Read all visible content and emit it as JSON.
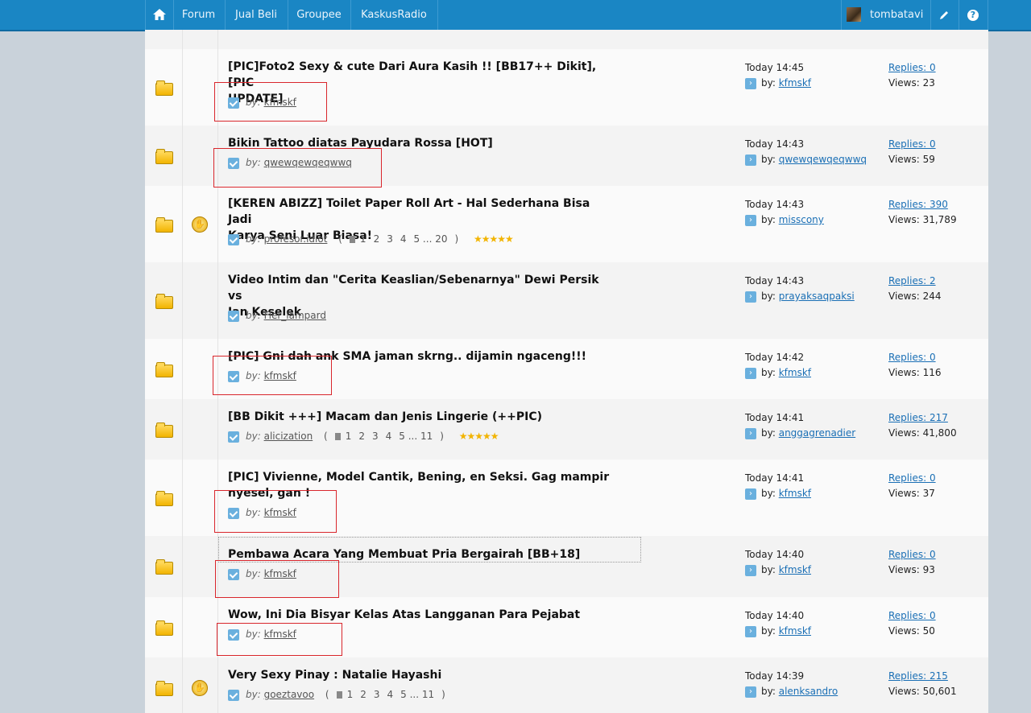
{
  "nav": {
    "forum": "Forum",
    "jual_beli": "Jual Beli",
    "groupee": "Groupee",
    "radio": "KaskusRadio",
    "user": "tombatavi",
    "help_symbol": "?"
  },
  "threads": [
    {
      "title1": "[PIC]Foto2 Sexy & cute Dari Aura Kasih !! [BB17++ Dikit],[PIC",
      "title2": "UPDATE]",
      "by_label": "by:",
      "author": "kfmskf",
      "time": "Today 14:45",
      "last_by_label": "by:",
      "last_user": "kfmskf",
      "replies": "Replies: 0",
      "views": "Views: 23"
    },
    {
      "title1": "Bikin Tattoo diatas Payudara Rossa [HOT]",
      "title2": "",
      "by_label": "by:",
      "author": "qwewqewqeqwwq",
      "time": "Today 14:43",
      "last_by_label": "by:",
      "last_user": "qwewqewqeqwwq",
      "replies": "Replies: 0",
      "views": "Views: 59"
    },
    {
      "title1": "[KEREN ABIZZ] Toilet Paper Roll Art - Hal Sederhana Bisa Jadi",
      "title2": "Karya Seni Luar Biasa!",
      "by_label": "by:",
      "author": "profesor.idiot",
      "pages": [
        "(",
        "1",
        "2",
        "3",
        "4",
        "5 ... 20",
        ")"
      ],
      "stars": "★★★★★",
      "time": "Today 14:43",
      "last_by_label": "by:",
      "last_user": "misscony",
      "replies": "Replies: 390",
      "views": "Views: 31,789"
    },
    {
      "title1": "Video Intim dan \"Cerita Keaslian/Sebenarnya\" Dewi Persik vs",
      "title2": "Ian Keselek",
      "by_label": "by:",
      "author": "Fier_lampard",
      "time": "Today 14:43",
      "last_by_label": "by:",
      "last_user": "prayaksaqpaksi",
      "replies": "Replies: 2",
      "views": "Views: 244"
    },
    {
      "title1": "[PIC] Gni dah ank SMA jaman skrng.. dijamin ngaceng!!!",
      "title2": "",
      "by_label": "by:",
      "author": "kfmskf",
      "time": "Today 14:42",
      "last_by_label": "by:",
      "last_user": "kfmskf",
      "replies": "Replies: 0",
      "views": "Views: 116"
    },
    {
      "title1": "[BB Dikit +++] Macam dan Jenis Lingerie (++PIC)",
      "title2": "",
      "by_label": "by:",
      "author": "alicization",
      "pages": [
        "(",
        "1",
        "2",
        "3",
        "4",
        "5 ... 11",
        ")"
      ],
      "stars": "★★★★★",
      "time": "Today 14:41",
      "last_by_label": "by:",
      "last_user": "anggagrenadier",
      "replies": "Replies: 217",
      "views": "Views: 41,800"
    },
    {
      "title1": "[PIC] Vivienne, Model Cantik, Bening, en Seksi. Gag mampir",
      "title2": "nyesel, gan !",
      "by_label": "by:",
      "author": "kfmskf",
      "time": "Today 14:41",
      "last_by_label": "by:",
      "last_user": "kfmskf",
      "replies": "Replies: 0",
      "views": "Views: 37"
    },
    {
      "title1": "Pembawa Acara Yang Membuat Pria Bergairah [BB+18]",
      "title2": "",
      "by_label": "by:",
      "author": "kfmskf",
      "time": "Today 14:40",
      "last_by_label": "by:",
      "last_user": "kfmskf",
      "replies": "Replies: 0",
      "views": "Views: 93"
    },
    {
      "title1": "Wow, Ini Dia Bisyar Kelas Atas Langganan Para Pejabat",
      "title2": "",
      "by_label": "by:",
      "author": "kfmskf",
      "time": "Today 14:40",
      "last_by_label": "by:",
      "last_user": "kfmskf",
      "replies": "Replies: 0",
      "views": "Views: 50"
    },
    {
      "title1": "Very Sexy Pinay : Natalie Hayashi",
      "title2": "",
      "by_label": "by:",
      "author": "goeztavoo",
      "pages": [
        "(",
        "1",
        "2",
        "3",
        "4",
        "5 ... 11",
        ")"
      ],
      "time": "Today 14:39",
      "last_by_label": "by:",
      "last_user": "alenksandro",
      "replies": "Replies: 215",
      "views": "Views: 50,601"
    }
  ]
}
